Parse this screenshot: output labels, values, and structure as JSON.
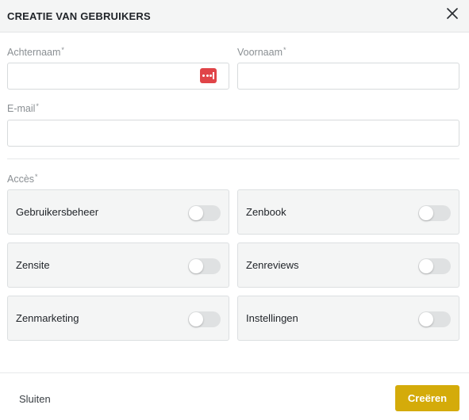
{
  "dialog": {
    "title": "CREATIE VAN GEBRUIKERS"
  },
  "form": {
    "lastname": {
      "label": "Achternaam",
      "required_mark": "*",
      "value": ""
    },
    "firstname": {
      "label": "Voornaam",
      "required_mark": "*",
      "value": ""
    },
    "email": {
      "label": "E-mail",
      "required_mark": "*",
      "value": ""
    }
  },
  "access": {
    "label": "Accès",
    "required_mark": "*",
    "items": [
      {
        "label": "Gebruikersbeheer",
        "enabled": false
      },
      {
        "label": "Zenbook",
        "enabled": false
      },
      {
        "label": "Zensite",
        "enabled": false
      },
      {
        "label": "Zenreviews",
        "enabled": false
      },
      {
        "label": "Zenmarketing",
        "enabled": false
      },
      {
        "label": "Instellingen",
        "enabled": false
      }
    ]
  },
  "footer": {
    "close_label": "Sluiten",
    "create_label": "Creëren"
  },
  "colors": {
    "primary": "#d4ab0a",
    "header_bg": "#f4f5f5",
    "card_bg": "#f4f5f5",
    "password_badge": "#e04448",
    "toggle_off": "#dfe1e2"
  },
  "icons": {
    "close": "close-icon",
    "password_manager": "password-manager-icon"
  }
}
